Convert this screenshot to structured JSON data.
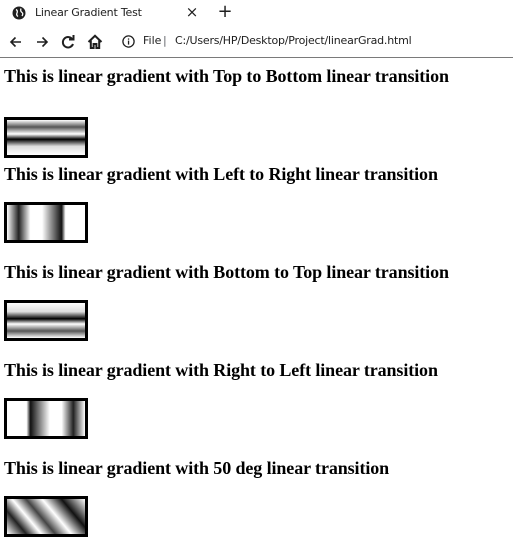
{
  "browser": {
    "tab_title": "Linear Gradient Test",
    "close_glyph": "×",
    "new_tab_glyph": "+",
    "url_scheme": "File",
    "url_separator": "|",
    "url": "C:/Users/HP/Desktop/Project/linearGrad.html",
    "icons": [
      "globe-icon",
      "close-icon",
      "plus-icon",
      "back-icon",
      "forward-icon",
      "reload-icon",
      "home-icon",
      "info-icon"
    ]
  },
  "page": {
    "demos": [
      {
        "heading": "This is linear gradient with Top to Bottom linear transition",
        "direction": "to bottom"
      },
      {
        "heading": "This is linear gradient with Left to Right linear transition",
        "direction": "to right"
      },
      {
        "heading": "This is linear gradient with Bottom to Top linear transition",
        "direction": "to top"
      },
      {
        "heading": "This is linear gradient with Right to Left linear transition",
        "direction": "to left"
      },
      {
        "heading": "This is linear gradient with 50 deg linear transition",
        "direction": "50deg"
      }
    ]
  }
}
